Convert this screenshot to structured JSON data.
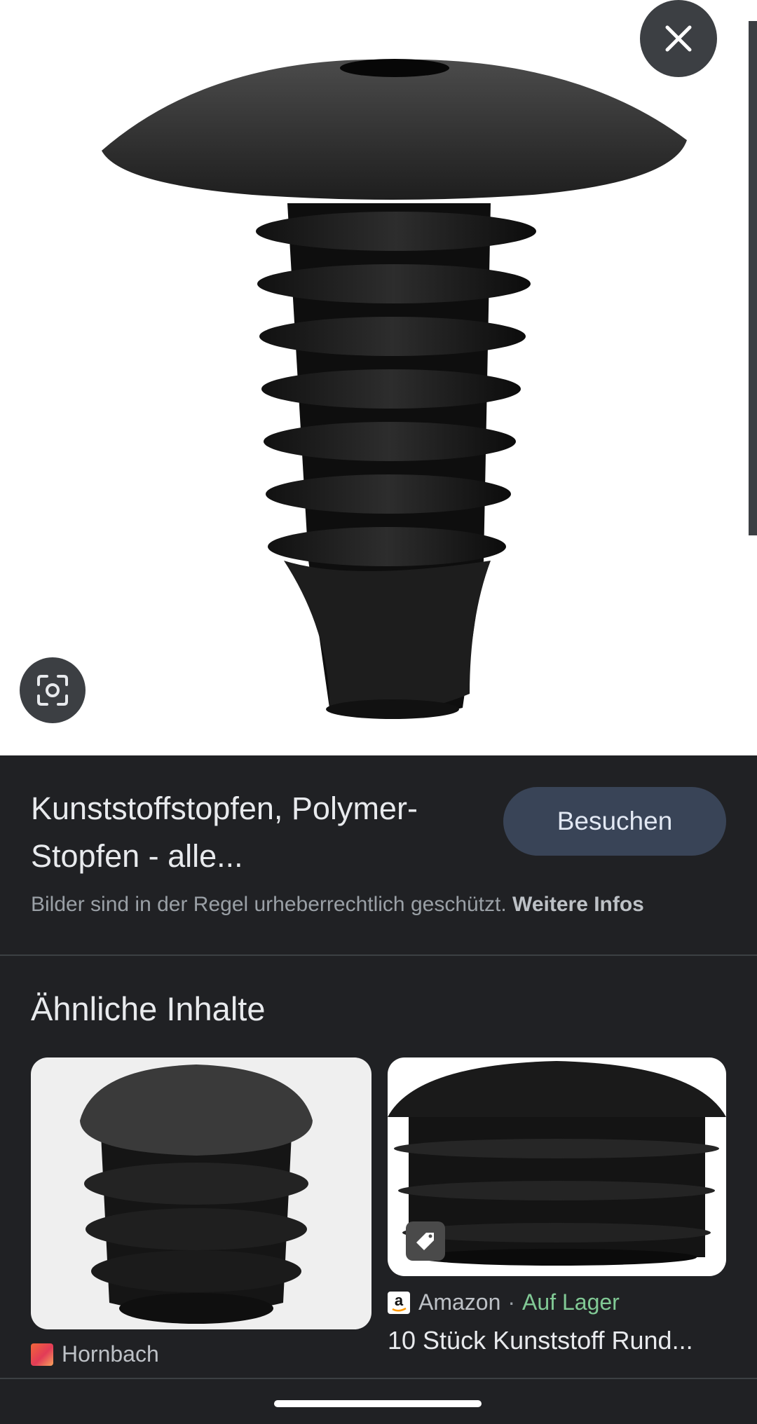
{
  "viewer": {
    "close_icon": "close-icon",
    "lens_icon": "google-lens-icon"
  },
  "result": {
    "title": "Kunststoffstopfen, Polymer-Stopfen - alle...",
    "visit_label": "Besuchen",
    "copyright_text": "Bilder sind in der Regel urheberrechtlich geschützt.",
    "more_info_label": "Weitere Infos"
  },
  "similar": {
    "heading": "Ähnliche Inhalte",
    "items": [
      {
        "source": "Hornbach",
        "favicon": "hornbach-favicon"
      },
      {
        "source": "Amazon",
        "availability": "Auf Lager",
        "title": "10 Stück Kunststoff Rund...",
        "favicon": "amazon-favicon",
        "badge_icon": "tag-icon"
      }
    ]
  },
  "colors": {
    "background": "#202124",
    "button": "#394457",
    "in_stock": "#81c995"
  }
}
